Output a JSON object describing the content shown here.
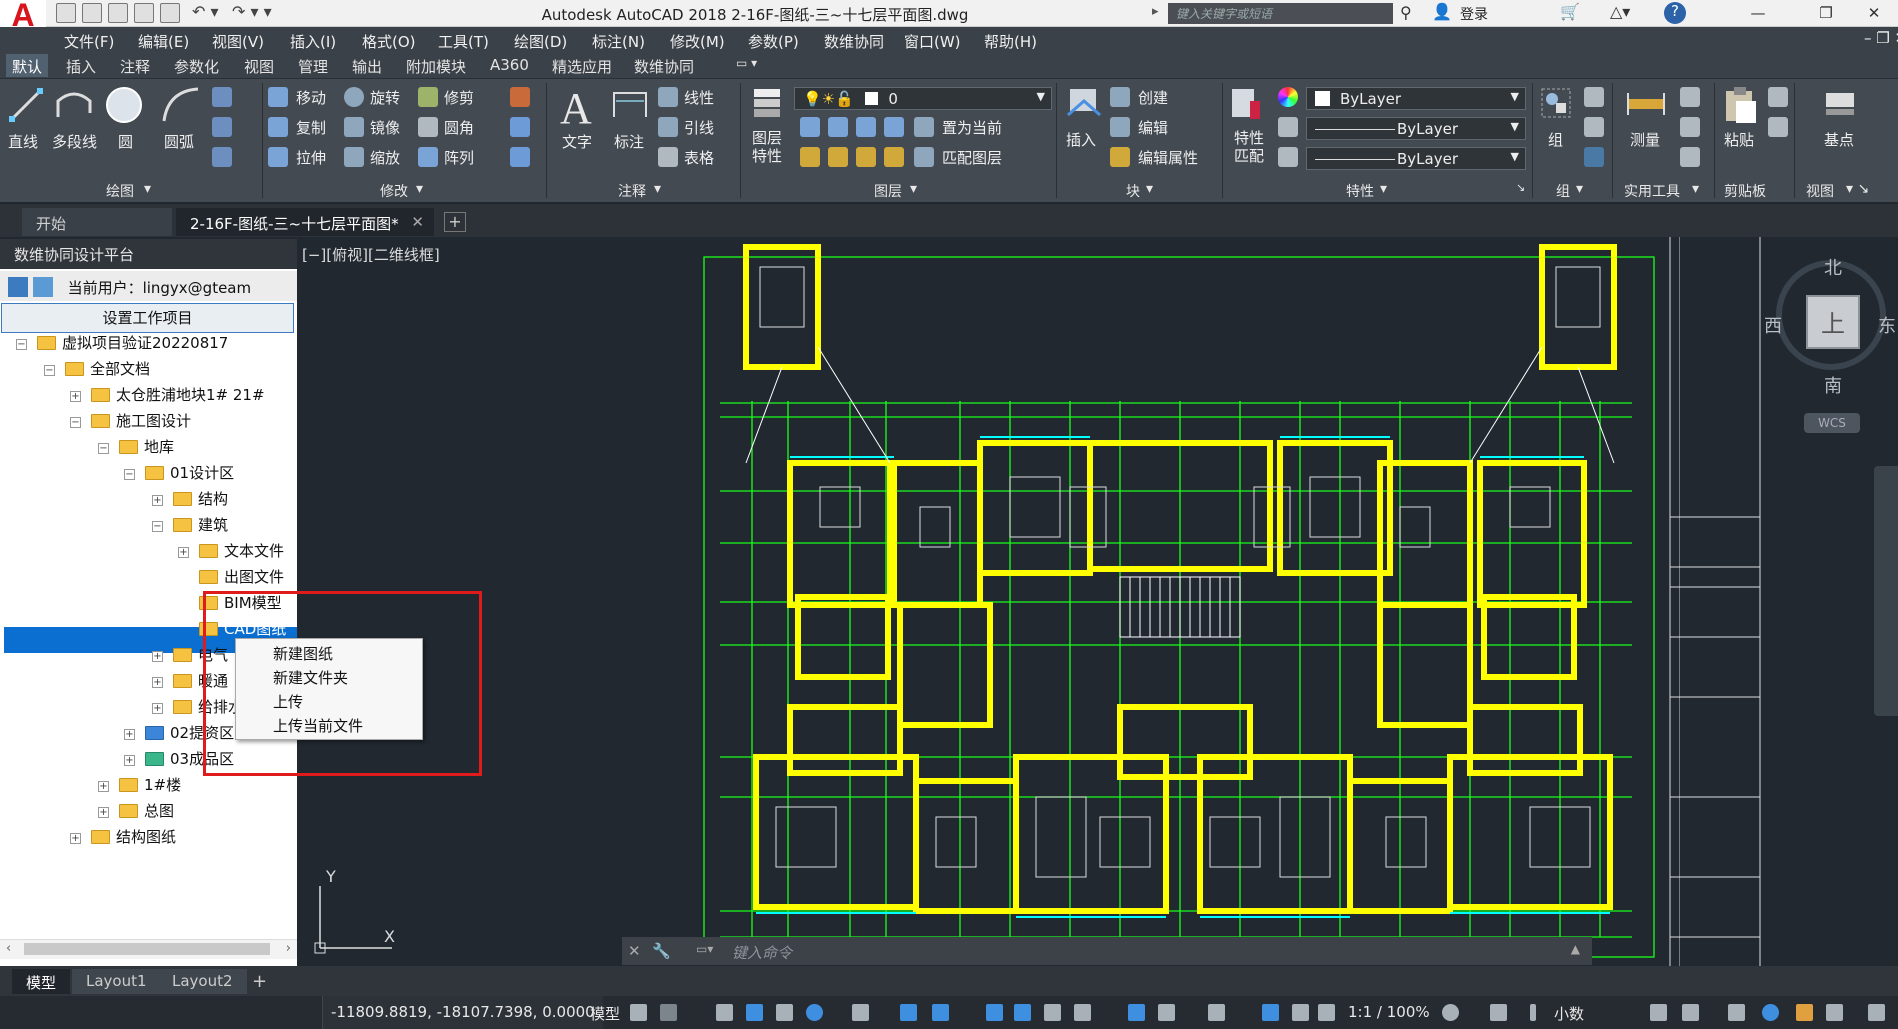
{
  "titlebar": {
    "app_logo": "A",
    "title": "Autodesk AutoCAD 2018    2-16F-图纸-三~十七层平面图.dwg",
    "search_placeholder": "键入关键字或短语",
    "login": "登录"
  },
  "menubar": [
    "文件(F)",
    "编辑(E)",
    "视图(V)",
    "插入(I)",
    "格式(O)",
    "工具(T)",
    "绘图(D)",
    "标注(N)",
    "修改(M)",
    "参数(P)",
    "数维协同",
    "窗口(W)",
    "帮助(H)"
  ],
  "ribbon_tabs": [
    "默认",
    "插入",
    "注释",
    "参数化",
    "视图",
    "管理",
    "输出",
    "附加模块",
    "A360",
    "精选应用",
    "数维协同"
  ],
  "ribbon": {
    "draw": {
      "title": "绘图",
      "tools": [
        "直线",
        "多段线",
        "圆",
        "圆弧"
      ]
    },
    "modify": {
      "title": "修改",
      "tools": [
        "移动",
        "旋转",
        "修剪",
        "复制",
        "镜像",
        "圆角",
        "拉伸",
        "缩放",
        "阵列"
      ]
    },
    "annotation": {
      "title": "注释",
      "tools": [
        "文字",
        "标注",
        "线性",
        "引线",
        "表格"
      ]
    },
    "layers": {
      "title": "图层",
      "layer_props": "图层特性",
      "current_layer": "0",
      "set_current": "置为当前",
      "match_layer": "匹配图层"
    },
    "block": {
      "title": "块",
      "insert": "插入",
      "create": "创建",
      "edit": "编辑",
      "edit_attr": "编辑属性"
    },
    "properties": {
      "title": "特性",
      "match": "特性匹配",
      "color": "ByLayer",
      "linetype": "ByLayer",
      "lineweight": "ByLayer"
    },
    "groups": {
      "title": "组",
      "group": "组"
    },
    "utilities": {
      "title": "实用工具",
      "measure": "测量"
    },
    "clipboard": {
      "title": "剪贴板",
      "paste": "粘贴"
    },
    "view": {
      "title": "视图",
      "base": "基点"
    }
  },
  "file_tabs": [
    "开始",
    "2-16F-图纸-三~十七层平面图*"
  ],
  "left_panel": {
    "header": "数维协同设计平台",
    "current_user": "当前用户：lingyx@gteam",
    "set_project_button": "设置工作项目",
    "tree": [
      {
        "label": "虚拟项目验证20220817",
        "level": 0,
        "toggle": "−"
      },
      {
        "label": "全部文档",
        "level": 1,
        "toggle": "−"
      },
      {
        "label": "太仓胜浦地块1# 21#",
        "level": 2,
        "toggle": "+"
      },
      {
        "label": "施工图设计",
        "level": 2,
        "toggle": "−"
      },
      {
        "label": "地库",
        "level": 3,
        "toggle": "−"
      },
      {
        "label": "01设计区",
        "level": 4,
        "toggle": "−"
      },
      {
        "label": "结构",
        "level": 5,
        "toggle": "+"
      },
      {
        "label": "建筑",
        "level": 5,
        "toggle": "−"
      },
      {
        "label": "文本文件",
        "level": 6,
        "toggle": "+"
      },
      {
        "label": "出图文件",
        "level": 6,
        "toggle": ""
      },
      {
        "label": "BIM模型",
        "level": 6,
        "toggle": ""
      },
      {
        "label": "CAD图纸",
        "level": 6,
        "toggle": ""
      },
      {
        "label": "电气",
        "level": 5,
        "toggle": "+"
      },
      {
        "label": "暖通",
        "level": 5,
        "toggle": "+"
      },
      {
        "label": "给排水",
        "level": 5,
        "toggle": "+"
      },
      {
        "label": "02提资区",
        "level": 4,
        "toggle": "+"
      },
      {
        "label": "03成品区",
        "level": 4,
        "toggle": "+"
      },
      {
        "label": "1#楼",
        "level": 3,
        "toggle": "+"
      },
      {
        "label": "总图",
        "level": 3,
        "toggle": "+"
      },
      {
        "label": "结构图纸",
        "level": 2,
        "toggle": "+"
      }
    ]
  },
  "context_menu": [
    "新建图纸",
    "新建文件夹",
    "上传",
    "上传当前文件"
  ],
  "viewport": {
    "label": "[−][俯视][二维线框]",
    "wcs": "WCS"
  },
  "viewcube": {
    "top": "上",
    "north": "北",
    "south": "南",
    "east": "东",
    "west": "西"
  },
  "command_line": {
    "placeholder": "键入命令"
  },
  "layout_tabs": [
    "模型",
    "Layout1",
    "Layout2"
  ],
  "status_bar": {
    "coords": "-11809.8819, -18107.7398, 0.0000",
    "model": "模型",
    "scale": "1:1 / 100%",
    "units": "小数"
  },
  "colors": {
    "accent": "#0a6fd1",
    "highlight_box": "#e01b1b",
    "wall": "#ffff00",
    "line_green": "#19ff19",
    "line_cyan": "#00ffff",
    "canvas": "#212830"
  }
}
